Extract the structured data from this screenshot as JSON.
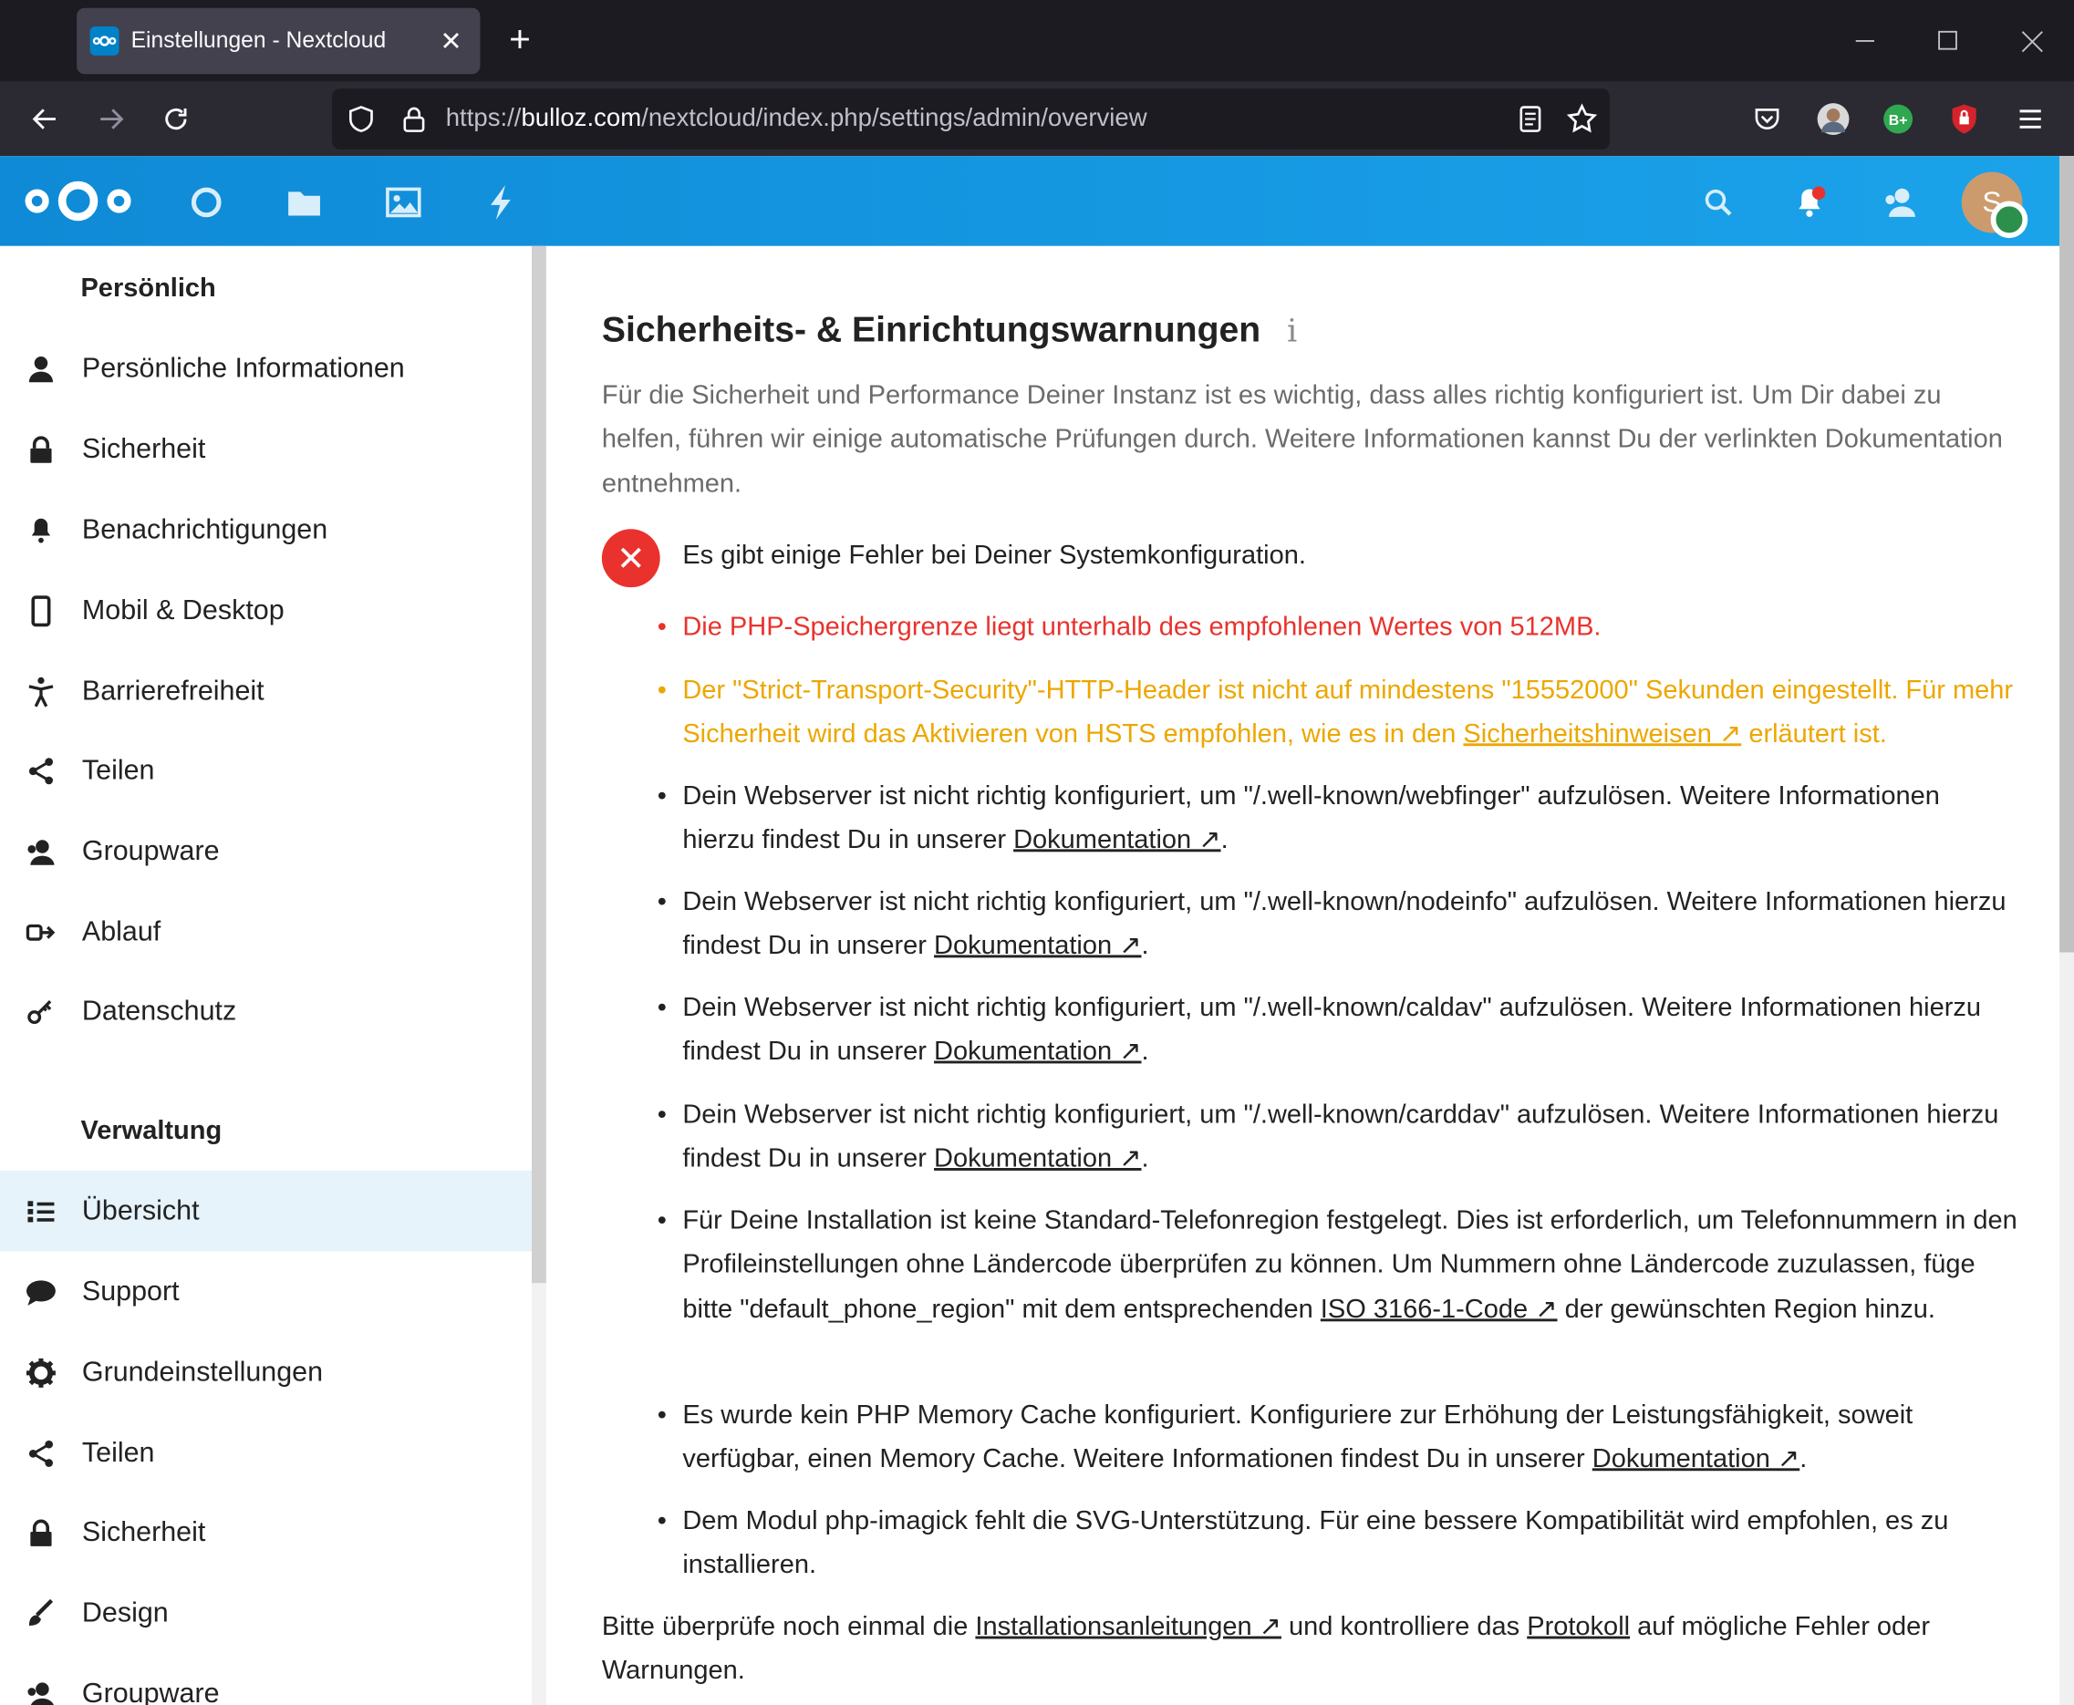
{
  "browser": {
    "tab_title": "Einstellungen - Nextcloud",
    "url_prefix": "https://",
    "url_host": "bulloz.com",
    "url_path": "/nextcloud/index.php/settings/admin/overview"
  },
  "header": {
    "avatar_initial": "S",
    "accent_color": "#0082c9"
  },
  "sidebar": {
    "personal_title": "Persönlich",
    "personal_items": [
      {
        "label": "Persönliche Informationen",
        "icon": "user-icon"
      },
      {
        "label": "Sicherheit",
        "icon": "lock-icon"
      },
      {
        "label": "Benachrichtigungen",
        "icon": "bell-icon"
      },
      {
        "label": "Mobil & Desktop",
        "icon": "phone-icon"
      },
      {
        "label": "Barrierefreiheit",
        "icon": "accessibility-icon"
      },
      {
        "label": "Teilen",
        "icon": "share-icon"
      },
      {
        "label": "Groupware",
        "icon": "contacts-icon"
      },
      {
        "label": "Ablauf",
        "icon": "flow-icon"
      },
      {
        "label": "Datenschutz",
        "icon": "key-icon"
      }
    ],
    "admin_title": "Verwaltung",
    "admin_items": [
      {
        "label": "Übersicht",
        "icon": "list-icon"
      },
      {
        "label": "Support",
        "icon": "chat-icon"
      },
      {
        "label": "Grundeinstellungen",
        "icon": "gear-icon"
      },
      {
        "label": "Teilen",
        "icon": "share-icon"
      },
      {
        "label": "Sicherheit",
        "icon": "lock-icon"
      },
      {
        "label": "Design",
        "icon": "brush-icon"
      },
      {
        "label": "Groupware",
        "icon": "contacts-icon"
      }
    ]
  },
  "main": {
    "title": "Sicherheits- & Einrichtungswarnungen",
    "intro": "Für die Sicherheit und Performance Deiner Instanz ist es wichtig, dass alles richtig konfiguriert ist. Um Dir dabei zu helfen, führen wir einige automatische Prüfungen durch. Weitere Informationen kannst Du der verlinkten Dokumentation entnehmen.",
    "error_heading": "Es gibt einige Fehler bei Deiner Systemkonfiguration.",
    "warnings": {
      "php_memory": "Die PHP-Speichergrenze liegt unterhalb des empfohlenen Wertes von 512MB.",
      "hsts_pre": "Der \"Strict-Transport-Security\"-HTTP-Header ist nicht auf mindestens \"15552000\" Sekunden eingestellt. Für mehr Sicherheit wird das Aktivieren von HSTS empfohlen, wie es in den ",
      "hsts_link": "Sicherheitshinweisen ↗",
      "hsts_post": " erläutert ist.",
      "webfinger_pre": "Dein Webserver ist nicht richtig konfiguriert, um \"/.well-known/webfinger\" aufzulösen. Weitere Informationen hierzu findest Du in unserer ",
      "nodeinfo_pre": "Dein Webserver ist nicht richtig konfiguriert, um \"/.well-known/nodeinfo\" aufzulösen. Weitere Informationen hierzu findest Du in unserer ",
      "caldav_pre": "Dein Webserver ist nicht richtig konfiguriert, um \"/.well-known/caldav\" aufzulösen. Weitere Informationen hierzu findest Du in unserer ",
      "carddav_pre": "Dein Webserver ist nicht richtig konfiguriert, um \"/.well-known/carddav\" aufzulösen. Weitere Informationen hierzu findest Du in unserer ",
      "doc_link": "Dokumentation ↗",
      "period": ".",
      "phone_pre": "Für Deine Installation ist keine Standard-Telefonregion festgelegt. Dies ist erforderlich, um Telefonnummern in den Profileinstellungen ohne Ländercode überprüfen zu können. Um Nummern ohne Ländercode zuzulassen, füge bitte \"default_phone_region\" mit dem entsprechenden ",
      "phone_link": "ISO 3166-1-Code ↗",
      "phone_post": " der gewünschten Region hinzu.",
      "memcache_pre": "Es wurde kein PHP Memory Cache konfiguriert. Konfiguriere zur Erhöhung der Leistungsfähigkeit, soweit verfügbar, einen Memory Cache. Weitere Informationen findest Du in unserer ",
      "imagick": "Dem Modul php-imagick fehlt die SVG-Unterstützung. Für eine bessere Kompatibilität wird empfohlen, es zu installieren."
    },
    "footer_pre": "Bitte überprüfe noch einmal die ",
    "footer_link1": "Installationsanleitungen ↗",
    "footer_mid": " und kontrolliere das ",
    "footer_link2": "Protokoll",
    "footer_post": " auf mögliche Fehler oder Warnungen."
  }
}
